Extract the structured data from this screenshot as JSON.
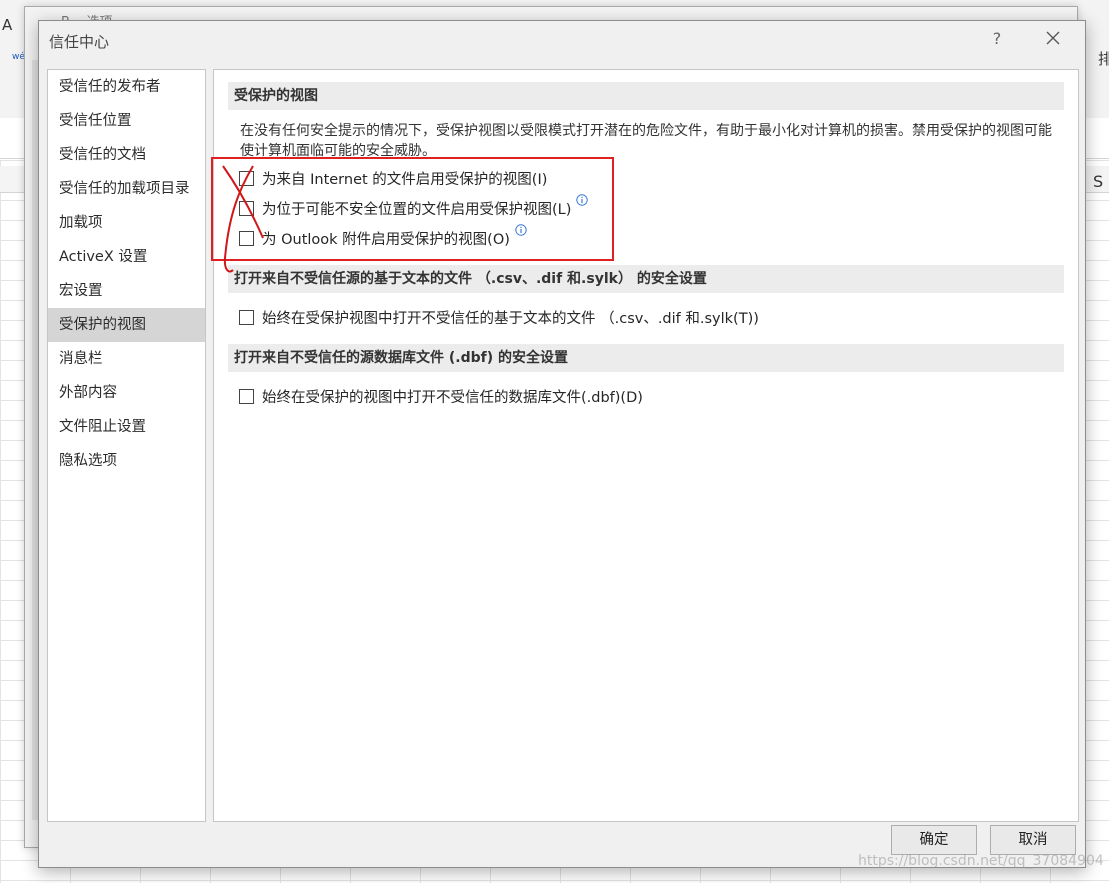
{
  "background": {
    "font_button_label": "A",
    "small_ribbon_text": "wén\n文",
    "arrange_glyph": "排",
    "column_letter": "S",
    "behind_window_title": "B   ...选项"
  },
  "dialog": {
    "title": "信任中心",
    "help_label": "?",
    "close_icon": "close-icon"
  },
  "nav": {
    "items": [
      {
        "label": "受信任的发布者",
        "active": false
      },
      {
        "label": "受信任位置",
        "active": false
      },
      {
        "label": "受信任的文档",
        "active": false
      },
      {
        "label": "受信任的加载项目录",
        "active": false
      },
      {
        "label": "加载项",
        "active": false
      },
      {
        "label": "ActiveX 设置",
        "active": false
      },
      {
        "label": "宏设置",
        "active": false
      },
      {
        "label": "受保护的视图",
        "active": true
      },
      {
        "label": "消息栏",
        "active": false
      },
      {
        "label": "外部内容",
        "active": false
      },
      {
        "label": "文件阻止设置",
        "active": false
      },
      {
        "label": "隐私选项",
        "active": false
      }
    ]
  },
  "content": {
    "protected_view": {
      "header": "受保护的视图",
      "description": "在没有任何安全提示的情况下，受保护视图以受限模式打开潜在的危险文件，有助于最小化对计算机的损害。禁用受保护的视图可能使计算机面临可能的安全威胁。",
      "options": [
        {
          "label": "为来自 Internet 的文件启用受保护的视图(I)",
          "checked": false,
          "info": false
        },
        {
          "label": "为位于可能不安全位置的文件启用受保护视图(L)",
          "checked": false,
          "info": true
        },
        {
          "label": "为 Outlook 附件启用受保护的视图(O)",
          "checked": false,
          "info": true
        }
      ]
    },
    "text_files": {
      "header": "打开来自不受信任源的基于文本的文件 （.csv、.dif 和.sylk） 的安全设置",
      "option": {
        "label": "始终在受保护视图中打开不受信任的基于文本的文件 （.csv、.dif 和.sylk(T))",
        "checked": false
      }
    },
    "database_files": {
      "header": "打开来自不受信任的源数据库文件 (.dbf) 的安全设置",
      "option": {
        "label": "始终在受保护的视图中打开不受信任的数据库文件(.dbf)(D)",
        "checked": false
      }
    }
  },
  "buttons": {
    "ok_label": "确定",
    "cancel_label": "取消"
  },
  "annotation": {
    "color": "#e02020"
  },
  "watermark": "https://blog.csdn.net/qq_37084904"
}
